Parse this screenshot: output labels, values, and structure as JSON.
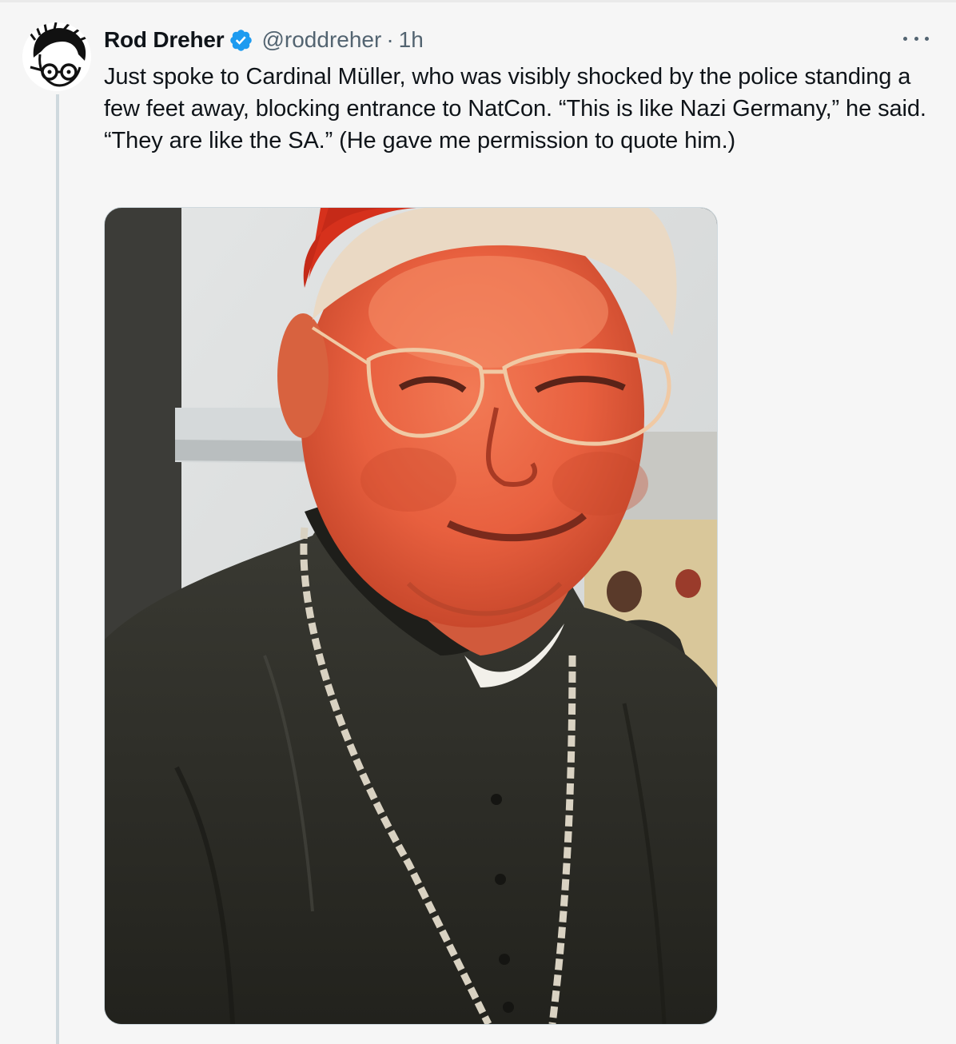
{
  "tweet": {
    "author": {
      "display_name": "Rod Dreher",
      "handle": "@roddreher",
      "verified": true,
      "avatar_icon": "caricature-avatar-icon"
    },
    "separator": "·",
    "timestamp": "1h",
    "text": "Just spoke to Cardinal Müller, who was visibly shocked by the police standing a few feet away, blocking entrance to NatCon. “This is like Nazi Germany,” he said. “They are like the SA.” (He gave me permission to quote him.)",
    "more_icon": "more-horizontal-icon"
  },
  "colors": {
    "background": "#f6f6f6",
    "text_primary": "#0f1419",
    "text_secondary": "#536471",
    "verified_blue": "#1d9bf0",
    "thread_line": "#cfd9de"
  }
}
